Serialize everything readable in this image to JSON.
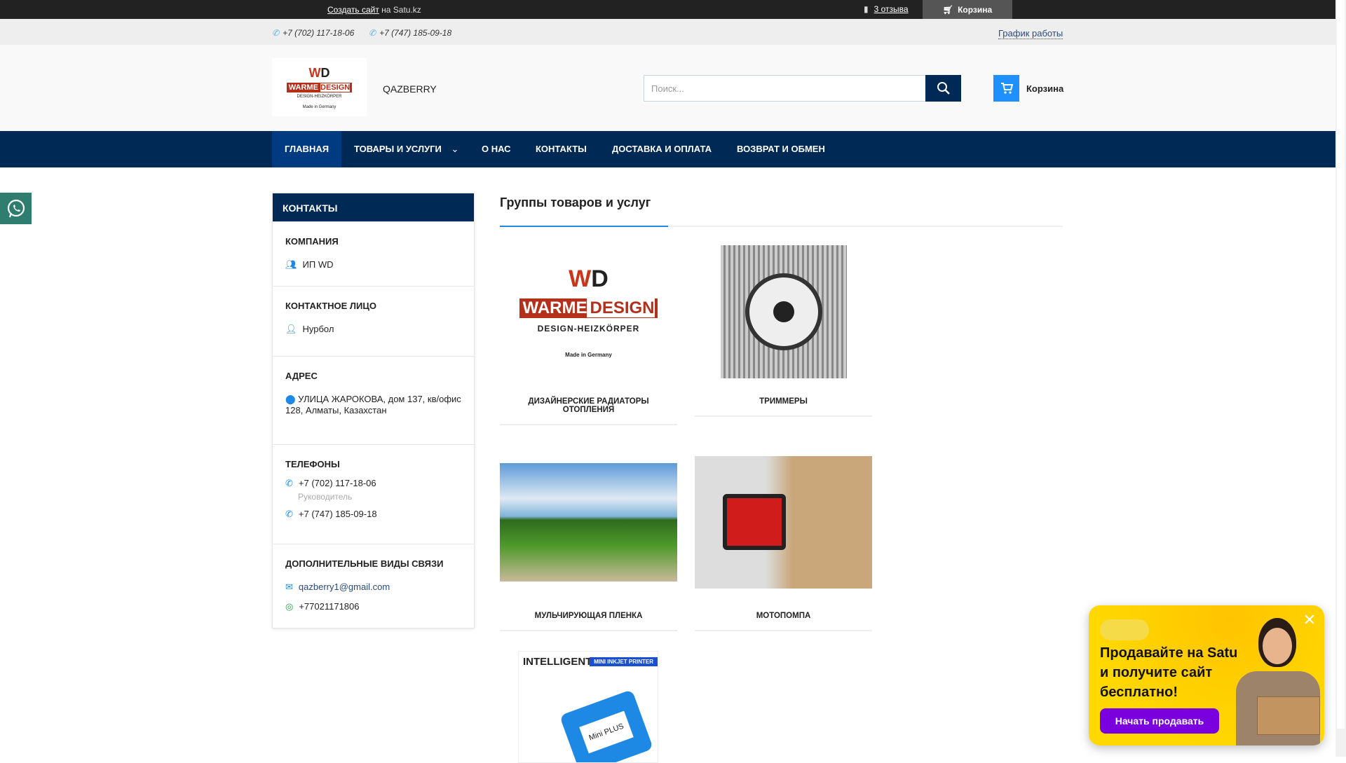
{
  "topbar": {
    "create_link": "Создать сайт",
    "create_suffix": "на Satu.kz",
    "reviews": "3 отзыва",
    "cart": "Корзина"
  },
  "phonebar": {
    "phone1": "+7 (702) 117-18-06",
    "phone2": "+7 (747) 185-09-18",
    "schedule": "График работы"
  },
  "header": {
    "logo_text": "WARME DESIGN",
    "logo_sub": "DESIGN-HEIZKÖRPER",
    "logo_small": "Made in Germany",
    "shop_name": "QAZBERRY",
    "search_placeholder": "Поиск...",
    "cart": "Корзина"
  },
  "nav": [
    {
      "label": "ГЛАВНАЯ"
    },
    {
      "label": "ТОВАРЫ И УСЛУГИ"
    },
    {
      "label": "О НАС"
    },
    {
      "label": "КОНТАКТЫ"
    },
    {
      "label": "ДОСТАВКА И ОПЛАТА"
    },
    {
      "label": "ВОЗВРАТ И ОБМЕН"
    }
  ],
  "sidebar": {
    "title": "КОНТАКТЫ",
    "company_h": "КОМПАНИЯ",
    "company": "ИП WD",
    "person_h": "КОНТАКТНОЕ ЛИЦО",
    "person": "Нурбол",
    "address_h": "АДРЕС",
    "address": "УЛИЦА ЖАРОКОВА, дом 137, кв/офис 128, Алматы, Казахстан",
    "phones_h": "ТЕЛЕФОНЫ",
    "phone1": "+7 (702) 117-18-06",
    "phone1_note": "Руководитель",
    "phone2": "+7 (747) 185-09-18",
    "extra_h": "ДОПОЛНИТЕЛЬНЫЕ ВИДЫ СВЯЗИ",
    "email": "qazberry1@gmail.com",
    "whatsapp": "+77021171806"
  },
  "main": {
    "title": "Группы товаров и услуг",
    "cards": [
      {
        "title": "ДИЗАЙНЕРСКИЕ РАДИАТОРЫ ОТОПЛЕНИЯ"
      },
      {
        "title": "ТРИММЕРЫ"
      },
      {
        "title": "МУЛЬЧИРУЮЩАЯ ПЛЕНКА"
      },
      {
        "title": "МОТОПОМПА"
      },
      {
        "title": ""
      }
    ],
    "printer_img_text": "INTELLIGENT",
    "printer_img_sub": "MINI INKJET PRINTER",
    "printer_img_label": "Mini PLUS"
  },
  "popup": {
    "text": "Продавайте на Satu и получите сайт бесплатно!",
    "button": "Начать продавать"
  },
  "colors": {
    "nav": "#002955",
    "accent": "#1e88e5",
    "popup": "#ffd800",
    "popup_button": "#7b00de"
  }
}
